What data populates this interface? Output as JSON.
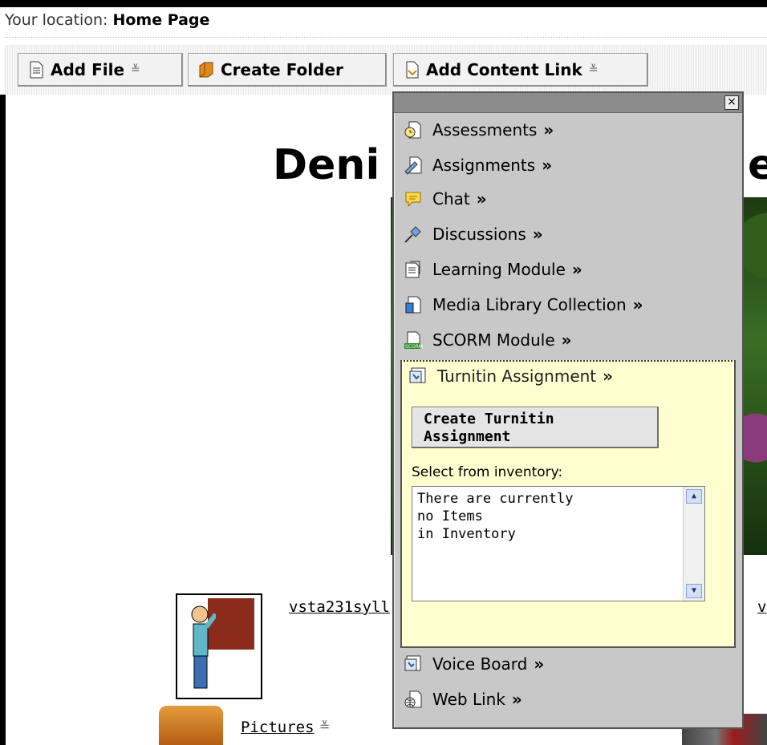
{
  "location": {
    "label": "Your location:",
    "value": "Home Page"
  },
  "toolbar": {
    "add_file": "Add File",
    "create_folder": "Create Folder",
    "add_content_link": "Add Content Link"
  },
  "page": {
    "title_left": "Deni",
    "title_right": "e",
    "syllabus_link": "vsta231syll",
    "right_link": "v",
    "pictures_link": "Pictures"
  },
  "menu": {
    "items": [
      {
        "label": "Assessments",
        "icon": "assessments-icon"
      },
      {
        "label": "Assignments",
        "icon": "assignments-icon"
      },
      {
        "label": "Chat",
        "icon": "chat-icon"
      },
      {
        "label": "Discussions",
        "icon": "discussions-icon"
      },
      {
        "label": "Learning Module",
        "icon": "learning-module-icon"
      },
      {
        "label": "Media Library Collection",
        "icon": "media-library-icon"
      },
      {
        "label": "SCORM Module",
        "icon": "scorm-icon"
      }
    ],
    "chevron": "»",
    "turnitin": {
      "label": "Turnitin Assignment",
      "create_button": "Create Turnitin Assignment",
      "inventory_label": "Select from inventory:",
      "inventory_lines": [
        "There are currently",
        "no Items",
        "in Inventory"
      ]
    },
    "bottom_items": [
      {
        "label": "Voice Board",
        "icon": "voice-board-icon"
      },
      {
        "label": "Web Link",
        "icon": "web-link-icon"
      }
    ],
    "close": "×"
  },
  "colors": {
    "menu_bg": "#c8c8c8",
    "menu_header": "#8c8c8c",
    "highlight_bg": "#ffffd0"
  }
}
